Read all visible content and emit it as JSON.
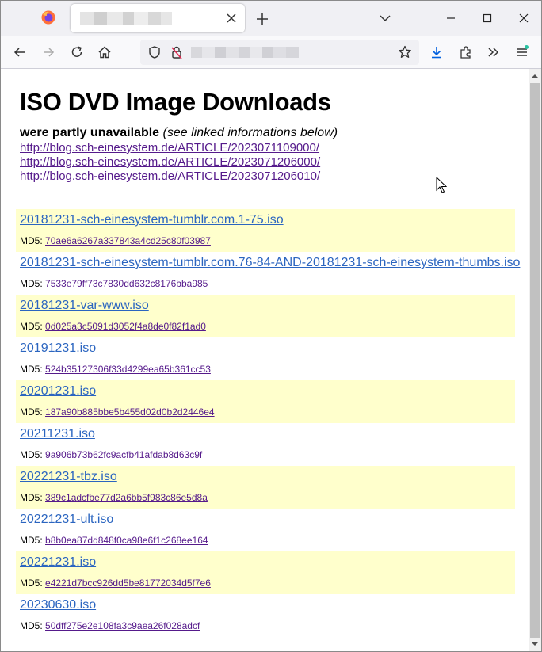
{
  "browser": {
    "accent": "#0060df"
  },
  "page": {
    "title": "ISO DVD Image Downloads",
    "subtitle_bold": "were partly unavailable",
    "subtitle_italic": "(see linked informations below)",
    "links": [
      "http://blog.sch-einesystem.de/ARTICLE/2023071109000/",
      "http://blog.sch-einesystem.de/ARTICLE/2023071206000/",
      "http://blog.sch-einesystem.de/ARTICLE/2023071206010/"
    ],
    "md5_label": "MD5:",
    "files": [
      {
        "name": "20181231-sch-einesystem-tumblr.com.1-75.iso",
        "md5": "70ae6a6267a337843a4cd25c80f03987"
      },
      {
        "name": "20181231-sch-einesystem-tumblr.com.76-84-AND-20181231-sch-einesystem-thumbs.iso",
        "md5": "7533e79ff73c7830dd632c8176bba985"
      },
      {
        "name": "20181231-var-www.iso",
        "md5": "0d025a3c5091d3052f4a8de0f82f1ad0"
      },
      {
        "name": "20191231.iso",
        "md5": "524b35127306f33d4299ea65b361cc53"
      },
      {
        "name": "20201231.iso",
        "md5": "187a90b885bbe5b455d02d0b2d2446e4"
      },
      {
        "name": "20211231.iso",
        "md5": "9a906b73b62fc9acfb41afdab8d63c9f"
      },
      {
        "name": "20221231-tbz.iso",
        "md5": "389c1adcfbe77d2a6bb5f983c86e5d8a"
      },
      {
        "name": "20221231-ult.iso",
        "md5": "b8b0ea87dd848f0ca98e6f1c268ee164"
      },
      {
        "name": "20221231.iso",
        "md5": "e4221d7bcc926dd5be81772034d5f7e6"
      },
      {
        "name": "20230630.iso",
        "md5": "50dff275e2e108fa3c9aea26f028adcf"
      }
    ]
  }
}
